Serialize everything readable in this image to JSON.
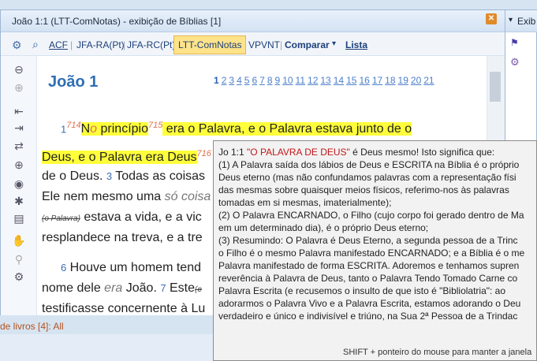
{
  "window": {
    "title": "João 1:1 (LTT-ComNotas)  - exibição de Bíblias [1]",
    "close": "✕"
  },
  "toolbar": {
    "items": [
      "ACF",
      "|",
      "JFA-RA(Pt)",
      "|",
      "JFA-RC(Pt)",
      "LTT-ComNotas",
      "VPVNT",
      "|",
      "Comparar",
      "▾",
      "Lista"
    ]
  },
  "right_pane": {
    "title": "Exib"
  },
  "book": {
    "name": "João 1",
    "chapters": [
      "1",
      "2",
      "3",
      "4",
      "5",
      "6",
      "7",
      "8",
      "9",
      "10",
      "11",
      "12",
      "13",
      "14",
      "15",
      "16",
      "17",
      "18",
      "19",
      "20",
      "21"
    ],
    "current_chapter": "1"
  },
  "text": {
    "v1": "1",
    "n714": "714",
    "t1a": "N",
    "t1b": "o",
    "t1c": " princípio",
    "n715": "715",
    "t1d": " era o Palavra, e o Palavra estava junto de o",
    "t2": "Deus, e o Palavra era Deus",
    "n716": "716",
    "t3a": "de o Deus. ",
    "v3": "3",
    "t3b": " Todas as coisas",
    "t4a": "Ele nem mesmo uma ",
    "t4b": "só coisa",
    "t5a": "(o Palavra)",
    "t5b": " estava a vida, e a vic",
    "t6": "resplandece na treva, e a tre",
    "v6": "6",
    "t7": " Houve um homem tend",
    "t8a": "nome dele ",
    "t8b": "era",
    "t8c": " João. ",
    "v7": "7",
    "t8d": " Este",
    "t8e": "(e",
    "t9": "testificasse concernente à Lu"
  },
  "popup": {
    "ref": "Jo 1:1 ",
    "quoted": "\"O PALAVRA DE DEUS\"",
    "rest": " é Deus mesmo! Isto significa que:",
    "lines": [
      "(1) A Palavra saída dos lábios de Deus e ESCRITA na Bíblia é o próprio",
      "Deus eterno (mas não confundamos palavras com a representação físi",
      "das mesmas sobre quaisquer meios físicos, referimo-nos às palavras",
      "tomadas em si mesmas, imaterialmente);",
      "(2) O Palavra ENCARNADO, o Filho (cujo corpo foi gerado dentro de Ma",
      "em um determinado dia), é o próprio Deus eterno;",
      "(3) Resumindo: O Palavra é Deus Eterno, a segunda pessoa de a Trinc",
      "o Filho é o mesmo Palavra manifestado ENCARNADO; e a Bíblia é o me",
      "Palavra manifestado de forma ESCRITA. Adoremos e tenhamos supren",
      "reverência à Palavra de Deus, tanto o Palavra Tendo Tomado Carne co",
      "Palavra Escrita (e recusemos o insulto de que isto é \"Bibliolatria\": ao",
      "adorarmos o Palavra Vivo e a Palavra Escrita, estamos adorando o Deu",
      "verdadeiro e único e indivisível e triúno, na Sua 2ª Pessoa de a Trindac"
    ],
    "hint": "SHIFT + ponteiro do mouse para manter a janela"
  },
  "status": {
    "text": "de livros [4]: All"
  },
  "colors": {
    "highlight": "#ffff3b",
    "accent": "#2e6fb4",
    "note": "#e0714a",
    "popup_quote": "#c0171a"
  }
}
